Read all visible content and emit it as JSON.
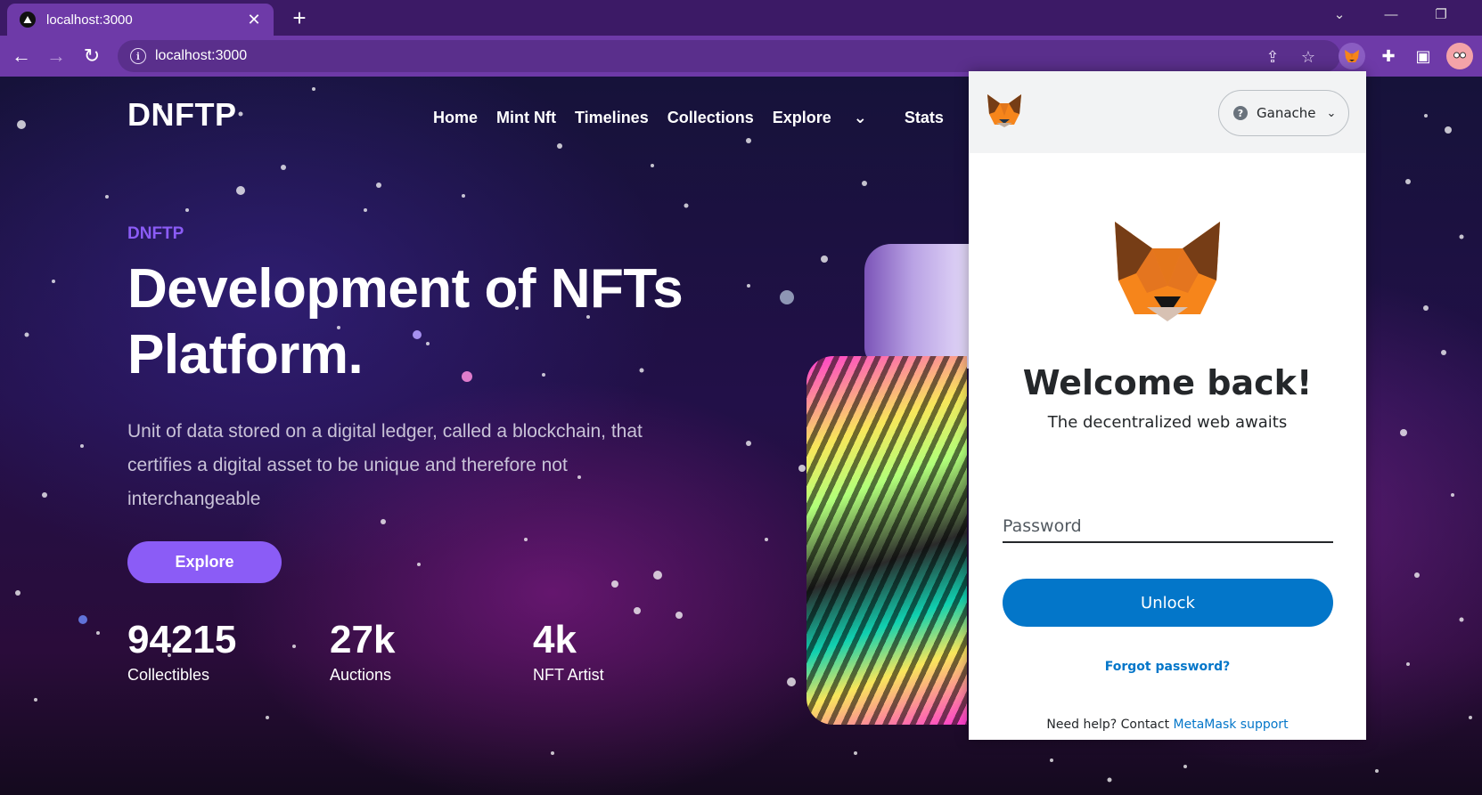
{
  "browser": {
    "tab_title": "localhost:3000",
    "url": "localhost:3000"
  },
  "site": {
    "brand": "DNFTP",
    "nav": [
      "Home",
      "Mint Nft",
      "Timelines",
      "Collections",
      "Explore",
      "Stats"
    ],
    "eyebrow": "DNFTP",
    "title_line1": "Development of NFTs",
    "title_line2": "Platform.",
    "description": "Unit of data stored on a digital ledger, called a blockchain, that certifies a digital asset to be unique and therefore not interchangeable",
    "explore_button": "Explore",
    "stats": [
      {
        "value": "94215",
        "label": "Collectibles"
      },
      {
        "value": "27k",
        "label": "Auctions"
      },
      {
        "value": "4k",
        "label": "NFT Artist"
      }
    ]
  },
  "metamask": {
    "network": "Ganache",
    "welcome": "Welcome back!",
    "tagline": "The decentralized web awaits",
    "password_placeholder": "Password",
    "unlock_button": "Unlock",
    "forgot_password": "Forgot password?",
    "help_prefix": "Need help? Contact",
    "help_link": "MetaMask support"
  },
  "colors": {
    "accent_purple": "#8b5cf6",
    "browser_frame": "#6e3aa8",
    "metamask_blue": "#0376c9"
  }
}
